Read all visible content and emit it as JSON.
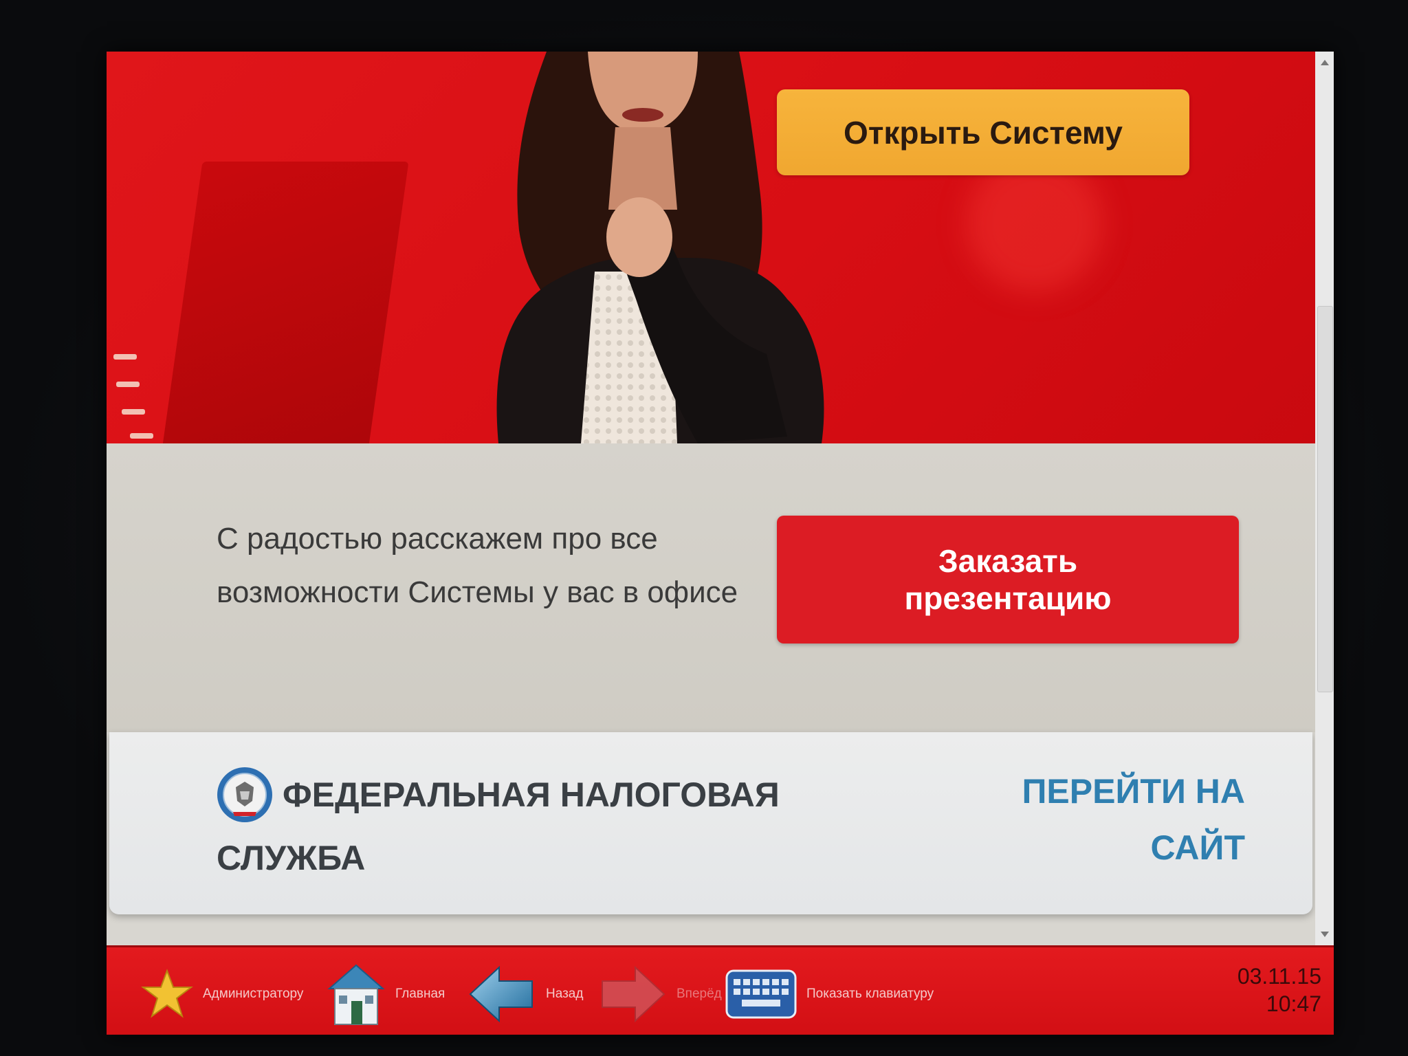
{
  "hero": {
    "open_system_label": "Открыть Систему"
  },
  "promo": {
    "text": "С радостью расскажем про все возможности Системы у вас в офисе",
    "order_button_line1": "Заказать",
    "order_button_line2": "презентацию"
  },
  "fns": {
    "title": "ФЕДЕРАЛЬНАЯ НАЛОГОВАЯ СЛУЖБА",
    "link_line1": "ПЕРЕЙТИ НА",
    "link_line2": "САЙТ",
    "emblem_icon": "fns-emblem-icon"
  },
  "kiosk_bar": {
    "items": [
      {
        "label": "Администратору",
        "icon": "star-icon",
        "enabled": true
      },
      {
        "label": "Главная",
        "icon": "home-icon",
        "enabled": true
      },
      {
        "label": "Назад",
        "icon": "back-arrow-icon",
        "enabled": true
      },
      {
        "label": "Вперёд",
        "icon": "forward-arrow-icon",
        "enabled": false
      },
      {
        "label": "Показать клавиатуру",
        "icon": "keyboard-icon",
        "enabled": true
      }
    ],
    "date": "03.11.15",
    "time": "10:47"
  },
  "colors": {
    "brand_red": "#dc1c24",
    "accent_orange": "#f0a730",
    "link_blue": "#2f7fb0"
  }
}
